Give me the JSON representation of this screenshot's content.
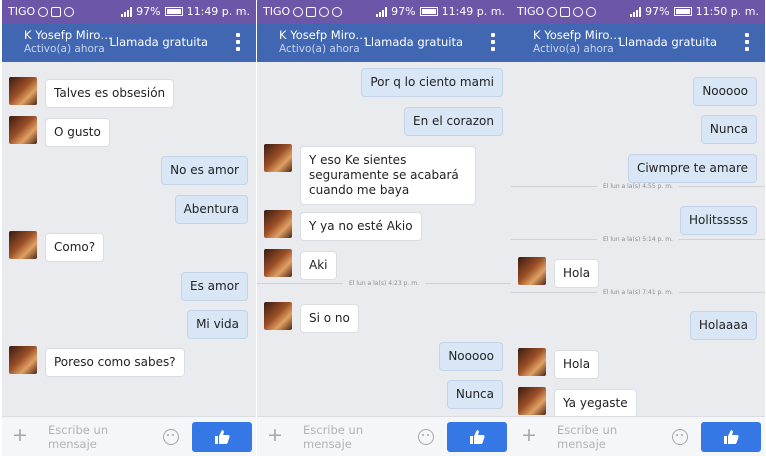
{
  "colors": {
    "statusbar": "#6b56a8",
    "header": "#4267b2",
    "chat_bg": "#e9ebee",
    "incoming": "#ffffff",
    "outgoing": "#d8e6f5",
    "like_button": "#3578e5"
  },
  "icons": [
    "message-icon",
    "photo-icon",
    "cloud-icon",
    "voicemail-icon",
    "signal-icon",
    "battery-icon",
    "more-menu-icon",
    "plus-icon",
    "emoji-icon",
    "thumbs-up-icon",
    "avatar"
  ],
  "common": {
    "contact_name": "K Yosefp Miro…",
    "status": "Activo(a) ahora",
    "call_label": "Llamada gratuita",
    "carrier": "TIGO",
    "input_placeholder": "Escribe un mensaje"
  },
  "panels": [
    {
      "battery": "97%",
      "time": "11:49 p. m.",
      "messages": [
        {
          "dir": "in",
          "text": "Talves es obsesión"
        },
        {
          "dir": "in",
          "text": "O gusto"
        },
        {
          "dir": "out",
          "text": "No es amor"
        },
        {
          "dir": "out",
          "text": "Abentura"
        },
        {
          "dir": "in",
          "text": "Como?"
        },
        {
          "dir": "out",
          "text": "Es amor"
        },
        {
          "dir": "out",
          "text": "Mi vida"
        },
        {
          "dir": "in",
          "text": "Poreso como sabes?"
        }
      ]
    },
    {
      "battery": "97%",
      "time": "11:49 p. m.",
      "messages": [
        {
          "dir": "out",
          "text": "Por q lo ciento mami"
        },
        {
          "dir": "out",
          "text": "En el corazon"
        },
        {
          "dir": "in",
          "text": "Y eso Ke sientes seguramente se acabará cuando me baya"
        },
        {
          "dir": "in",
          "text": "Y ya no esté Akio"
        },
        {
          "dir": "in",
          "text": "Aki"
        },
        {
          "dir": "in",
          "text": "Si o no"
        },
        {
          "dir": "out",
          "text": "Nooooo"
        },
        {
          "dir": "out",
          "text": "Nunca"
        }
      ],
      "timestamps": [
        "El lun a la(s) 4:23 p. m."
      ]
    },
    {
      "battery": "97%",
      "time": "11:50 p. m.",
      "messages": [
        {
          "dir": "out",
          "text": "Nooooo"
        },
        {
          "dir": "out",
          "text": "Nunca"
        },
        {
          "dir": "out",
          "text": "Ciwmpre te amare"
        },
        {
          "dir": "out",
          "text": "Holitsssss"
        },
        {
          "dir": "in",
          "text": "Hola"
        },
        {
          "dir": "out",
          "text": "Holaaaa"
        },
        {
          "dir": "in",
          "text": "Hola"
        },
        {
          "dir": "in",
          "text": "Ya yegaste"
        }
      ],
      "timestamps": [
        "El lun a la(s) 4:55 p. m.",
        "El lun a la(s) 5:14 p. m.",
        "El lun a la(s) 7:41 p. m."
      ]
    }
  ]
}
